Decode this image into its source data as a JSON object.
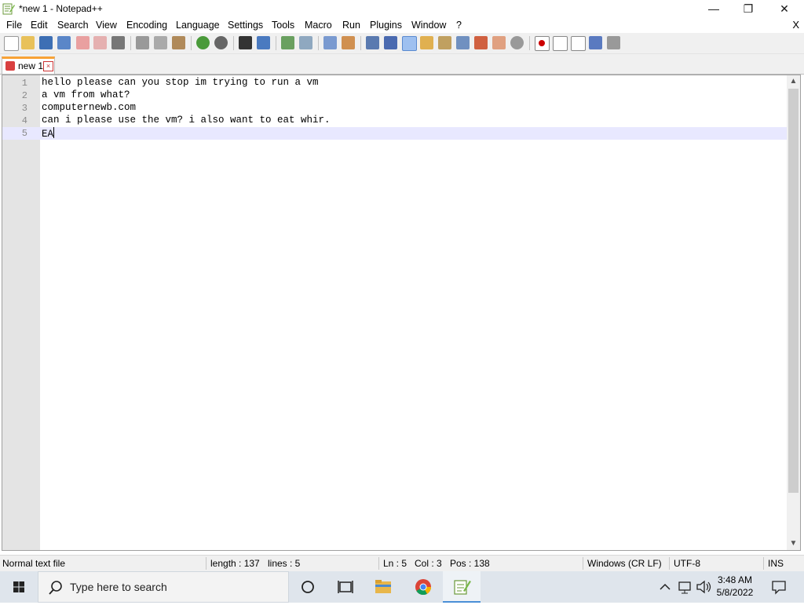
{
  "window": {
    "title": "*new 1 - Notepad++",
    "controls": {
      "minimize": "—",
      "maximize": "❐",
      "close": "✕"
    }
  },
  "menu": {
    "items": [
      "File",
      "Edit",
      "Search",
      "View",
      "Encoding",
      "Language",
      "Settings",
      "Tools",
      "Macro",
      "Run",
      "Plugins",
      "Window",
      "?"
    ],
    "close_label": "X"
  },
  "tabs": [
    {
      "label": "new 1",
      "close": "×"
    }
  ],
  "editor": {
    "lines": [
      {
        "num": "1",
        "text": "hello please can you stop im trying to run a vm"
      },
      {
        "num": "2",
        "text": "a vm from what?"
      },
      {
        "num": "3",
        "text": "computernewb.com"
      },
      {
        "num": "4",
        "text": "can i please use the vm? i also want to eat whir."
      },
      {
        "num": "5",
        "text": "EA"
      }
    ],
    "current_line_index": 4
  },
  "status": {
    "file_type": "Normal text file",
    "length": "length : 137",
    "lines": "lines : 5",
    "ln": "Ln : 5",
    "col": "Col : 3",
    "pos": "Pos : 138",
    "eol": "Windows (CR LF)",
    "encoding": "UTF-8",
    "mode": "INS"
  },
  "taskbar": {
    "search_placeholder": "Type here to search",
    "clock_time": "3:48 AM",
    "clock_date": "5/8/2022"
  },
  "colors": {
    "tab_accent": "#f8a236",
    "current_line": "#e8e8ff",
    "gutter": "#e4e4e4",
    "taskbar": "#dfe5ec"
  }
}
